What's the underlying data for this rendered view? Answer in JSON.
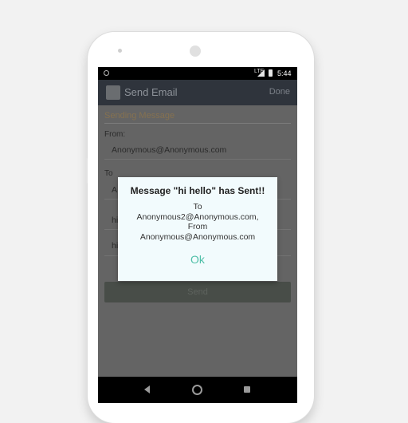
{
  "status_bar": {
    "network": "LTE",
    "time": "5:44"
  },
  "toolbar": {
    "title": "Send Email",
    "done_label": "Done"
  },
  "form": {
    "section_title": "Sending Message",
    "from_label": "From:",
    "from_value": "Anonymous@Anonymous.com",
    "to_label": "To",
    "to_value_partial": "A",
    "subject_partial": "hi",
    "body_partial": "hi",
    "send_label": "Send"
  },
  "dialog": {
    "title": "Message \"hi hello\" has Sent!!",
    "line1": "To",
    "line2": "Anonymous2@Anonymous.com,",
    "line3": "From",
    "line4": "Anonymous@Anonymous.com",
    "ok_label": "Ok"
  },
  "colors": {
    "accent": "#4fbfa8",
    "toolbar": "#2f343c",
    "dialog_bg": "#f2fbfd",
    "scrim": "#646464"
  }
}
